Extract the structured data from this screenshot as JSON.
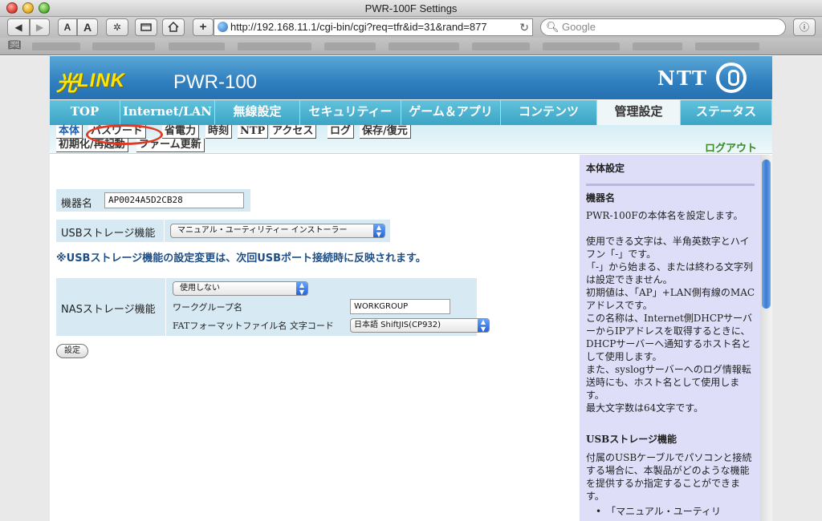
{
  "browser": {
    "window_title": "PWR-100F Settings",
    "url": "http://192.168.11.1/cgi-bin/cgi?req=tfr&id=31&rand=877",
    "search_placeholder": "Google",
    "text_small_label": "A",
    "text_large_label": "A",
    "add_label": "+",
    "back_label": "◀",
    "forward_label": "▶"
  },
  "header": {
    "logo_hikari": "光",
    "logo_link": "LINK",
    "product_name": "PWR-100",
    "brand": "NTT"
  },
  "main_nav": {
    "tabs": [
      {
        "label": "TOP",
        "active": false
      },
      {
        "label": "Internet/LAN",
        "active": false
      },
      {
        "label": "無線設定",
        "active": false
      },
      {
        "label": "セキュリティー",
        "active": false
      },
      {
        "label": "ゲーム＆アプリ",
        "active": false
      },
      {
        "label": "コンテンツ",
        "active": false
      },
      {
        "label": "管理設定",
        "active": true
      },
      {
        "label": "ステータス",
        "active": false
      }
    ]
  },
  "sub_nav": {
    "tabs": [
      {
        "label": "本体",
        "active": true
      },
      {
        "label": "パスワード",
        "active": false
      },
      {
        "label": "省電力",
        "active": false
      },
      {
        "label": "時刻",
        "active": false
      },
      {
        "label": "NTP",
        "active": false
      },
      {
        "label": "アクセス",
        "active": false
      },
      {
        "label": "ログ",
        "active": false
      },
      {
        "label": "保存/復元",
        "active": false
      },
      {
        "label": "初期化/再起動",
        "active": false
      },
      {
        "label": "ファーム更新",
        "active": false
      }
    ],
    "logout": "ログアウト"
  },
  "form": {
    "device_name_label": "機器名",
    "device_name_value": "AP0024A5D2CB28",
    "usb_label": "USBストレージ機能",
    "usb_value": "マニュアル・ユーティリティー インストーラー",
    "usb_notice": "※USBストレージ機能の設定変更は、次回USBポート接続時に反映されます。",
    "nas_label": "NASストレージ機能",
    "nas_value": "使用しない",
    "workgroup_label": "ワークグループ名",
    "workgroup_value": "WORKGROUP",
    "fat_label": "FATフォーマットファイル名 文字コード",
    "fat_value": "日本語 ShiftJIS(CP932)",
    "submit": "設定"
  },
  "help": {
    "title": "本体設定",
    "sections": [
      {
        "heading": "機器名",
        "paragraphs": [
          "PWR-100Fの本体名を設定します。",
          "使用できる文字は、半角英数字とハイフン「-」です。",
          "「-」から始まる、または終わる文字列は設定できません。",
          "初期値は、「AP」+LAN側有線のMACアドレスです。",
          "この名称は、Internet側DHCPサーバーからIPアドレスを取得するときに、DHCPサーバーへ通知するホスト名として使用します。",
          "また、syslogサーバーへのログ情報転送時にも、ホスト名として使用します。",
          "最大文字数は64文字です。"
        ]
      },
      {
        "heading": "USBストレージ機能",
        "paragraphs": [
          "付属のUSBケーブルでパソコンと接続する場合に、本製品がどのような機能を提供するか指定することができます。",
          "•　「マニュアル・ユーティリ"
        ]
      }
    ]
  },
  "colors": {
    "header_blue": "#2f7fbf",
    "nav_cyan": "#4bb3d0",
    "logo_yellow": "#ffe600",
    "notice_blue": "#1e4e86",
    "logout_green": "#3a8a2a",
    "highlight_red": "#e03a24",
    "help_bg": "#dedef9"
  },
  "icons": [
    "back-icon",
    "forward-icon",
    "gear-icon",
    "window-icon",
    "home-icon",
    "add-icon",
    "globe-icon",
    "reload-icon",
    "search-icon",
    "bug-icon",
    "bookmarks-icon"
  ]
}
